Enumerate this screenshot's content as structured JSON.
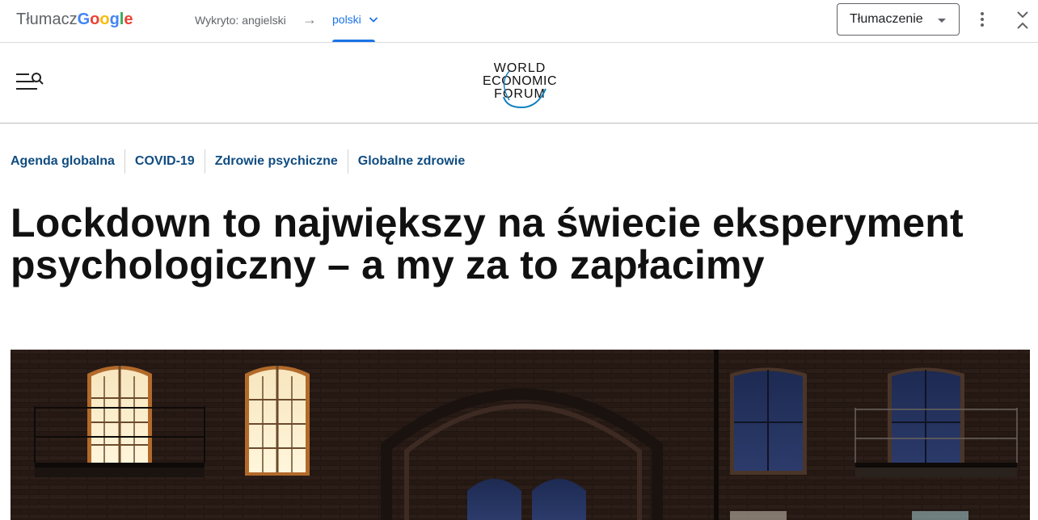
{
  "translate_bar": {
    "brand_prefix": "Tłumacz",
    "brand_letters": [
      "G",
      "o",
      "o",
      "g",
      "l",
      "e"
    ],
    "brand_colors": [
      "#4285f4",
      "#ea4335",
      "#fbbc05",
      "#4285f4",
      "#34a853",
      "#ea4335"
    ],
    "detected_label": "Wykryto: angielski",
    "arrow": "→",
    "target_language": "polski",
    "mode_select_value": "Tłumaczenie",
    "accent_color": "#1a73e8"
  },
  "site": {
    "logo_lines": [
      "WORLD",
      "ECONOMIC",
      "FORUM"
    ],
    "menu_icon": "menu-search-icon"
  },
  "breadcrumb": [
    "Agenda globalna",
    "COVID-19",
    "Zdrowie psychiczne",
    "Globalne zdrowie"
  ],
  "article": {
    "title": "Lockdown to największy na świecie eksperyment psychologiczny – a my za to zapłacimy"
  }
}
